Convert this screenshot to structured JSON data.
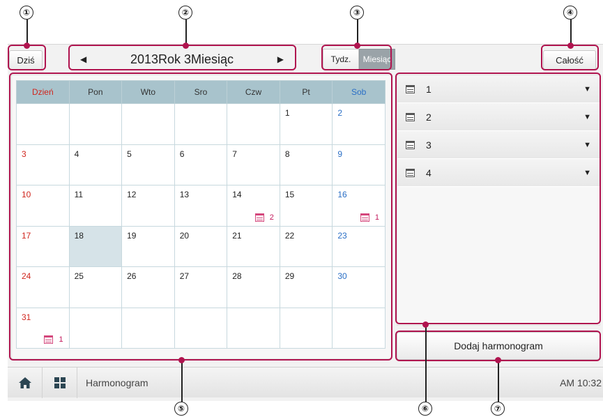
{
  "callouts": [
    "①",
    "②",
    "③",
    "④",
    "⑤",
    "⑥",
    "⑦"
  ],
  "top_bar": {
    "today_label": "Dziś",
    "month_title": "2013Rok 3Miesiąc",
    "prev_icon": "triangle-left",
    "next_icon": "triangle-right",
    "view_week": "Tydz.",
    "view_month": "Miesiąc",
    "all_label": "Całość"
  },
  "calendar": {
    "headers": [
      "Dzień",
      "Pon",
      "Wto",
      "Sro",
      "Czw",
      "Pt",
      "Sob"
    ],
    "weeks": [
      [
        "",
        "",
        "",
        "",
        "",
        "1",
        "2"
      ],
      [
        "3",
        "4",
        "5",
        "6",
        "7",
        "8",
        "9"
      ],
      [
        "10",
        "11",
        "12",
        "13",
        "14",
        "15",
        "16"
      ],
      [
        "17",
        "18",
        "19",
        "20",
        "21",
        "22",
        "23"
      ],
      [
        "24",
        "25",
        "26",
        "27",
        "28",
        "29",
        "30"
      ],
      [
        "31",
        "",
        "",
        "",
        "",
        "",
        ""
      ]
    ],
    "today": "18",
    "schedule_counts": {
      "14": "2",
      "16": "1",
      "31": "1"
    }
  },
  "schedule_list": {
    "items": [
      {
        "label": "1"
      },
      {
        "label": "2"
      },
      {
        "label": "3"
      },
      {
        "label": "4"
      }
    ]
  },
  "add_button_label": "Dodaj harmonogram",
  "bottom_bar": {
    "title": "Harmonogram",
    "time": "AM 10:32"
  },
  "colors": {
    "accent": "#b0144f",
    "header_bg": "#a8c3cc",
    "sunday": "#d0261e",
    "saturday": "#2a6fc6",
    "today_bg": "#d6e3e8"
  }
}
